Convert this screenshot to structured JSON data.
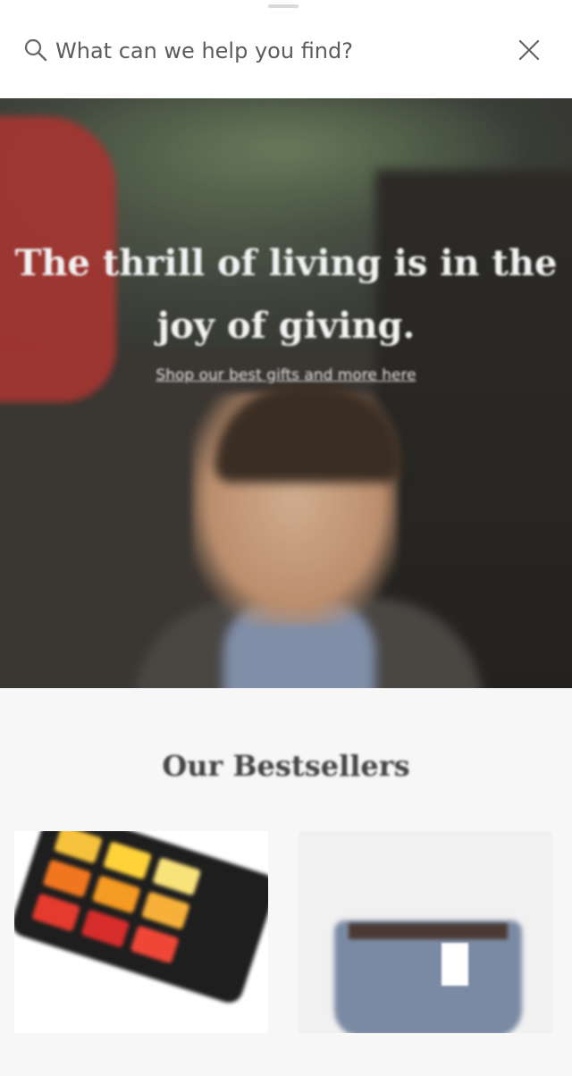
{
  "search": {
    "placeholder": "What can we help you find?",
    "value": ""
  },
  "hero": {
    "title": "The thrill of living is in the joy of giving.",
    "link": "Shop our best gifts and more here"
  },
  "bestsellers": {
    "title": "Our Bestsellers",
    "products": [
      {
        "name": "watercolor palette set"
      },
      {
        "name": "printed shorts"
      }
    ]
  },
  "colors": {
    "background": "#f7f7f8",
    "search_bar": "#ffffff"
  }
}
